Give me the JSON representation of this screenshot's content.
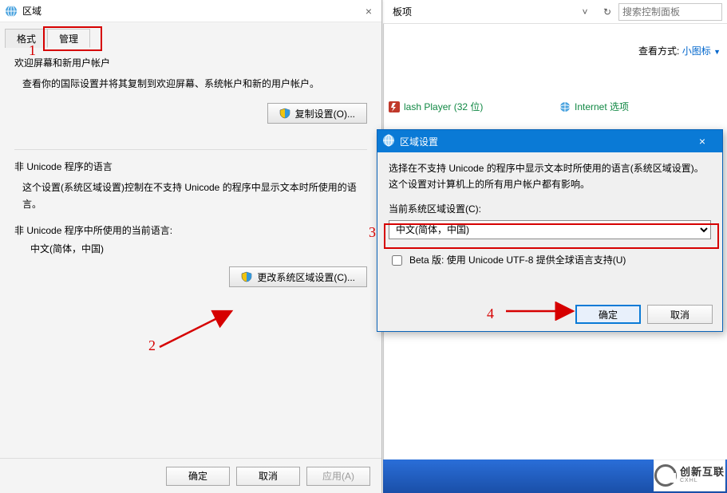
{
  "bg": {
    "crumb_trail": "板项",
    "refresh_tip": "刷新",
    "search_placeholder": "搜索控制面板",
    "view_label": "查看方式:",
    "view_value": "小图标",
    "items": {
      "flash": "lash Player (32 位)",
      "internet": "Internet 选项"
    }
  },
  "region": {
    "title": "区域",
    "close": "×",
    "tabs": {
      "format": "格式",
      "admin": "管理"
    },
    "welcome_group": {
      "title": "欢迎屏幕和新用户帐户",
      "desc": "查看你的国际设置并将其复制到欢迎屏幕、系统帐户和新的用户帐户。",
      "btn": "复制设置(O)..."
    },
    "nonunicode_group": {
      "title": "非 Unicode 程序的语言",
      "desc": "这个设置(系统区域设置)控制在不支持 Unicode 的程序中显示文本时所使用的语言。",
      "cur_label": "非 Unicode 程序中所使用的当前语言:",
      "cur_value": "中文(简体，中国)",
      "btn": "更改系统区域设置(C)..."
    },
    "footer": {
      "ok": "确定",
      "cancel": "取消",
      "apply": "应用(A)"
    }
  },
  "locale": {
    "title": "区域设置",
    "close": "×",
    "desc": "选择在不支持 Unicode 的程序中显示文本时所使用的语言(系统区域设置)。这个设置对计算机上的所有用户帐户都有影响。",
    "label": "当前系统区域设置(C):",
    "value": "中文(简体，中国)",
    "beta": "Beta 版: 使用 Unicode UTF-8 提供全球语言支持(U)",
    "ok": "确定",
    "cancel": "取消"
  },
  "anno": {
    "n1": "1",
    "n2": "2",
    "n3": "3",
    "n4": "4"
  },
  "logo": {
    "brand": "创新互联",
    "sub": "CXHL"
  }
}
